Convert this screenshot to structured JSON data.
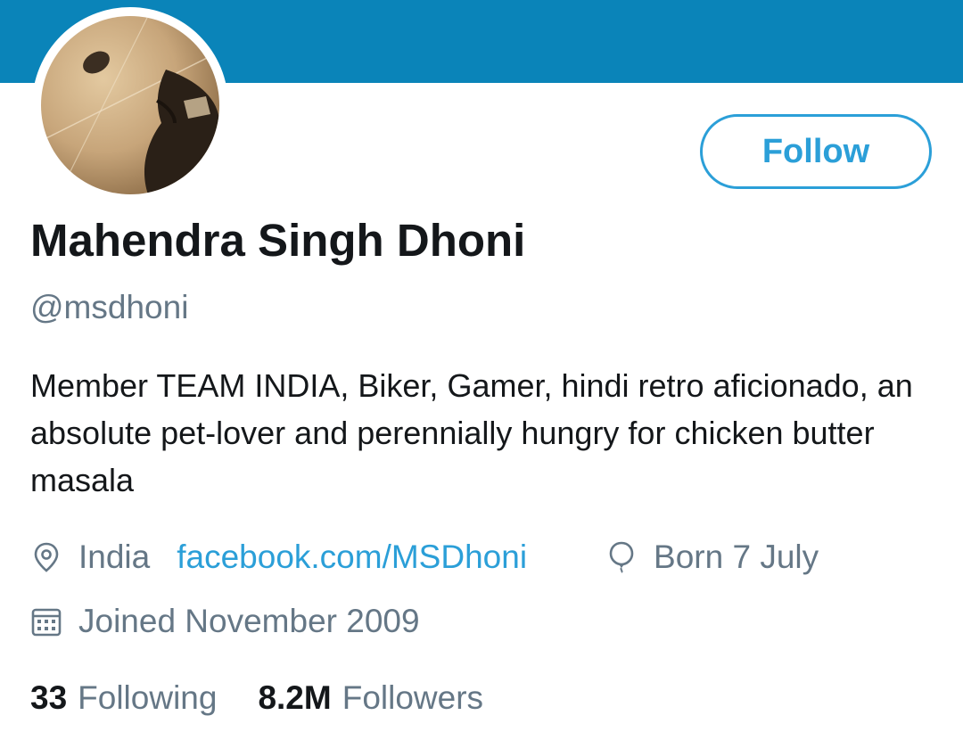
{
  "profile": {
    "name": "Mahendra Singh Dhoni",
    "handle": "@msdhoni",
    "bio": "Member TEAM INDIA, Biker, Gamer, hindi retro aficionado, an absolute pet-lover and perennially hungry for chicken butter masala",
    "location": "India",
    "website": "facebook.com/MSDhoni",
    "birthday": "Born 7 July",
    "joined": "Joined November 2009"
  },
  "actions": {
    "follow_label": "Follow"
  },
  "stats": {
    "following_count": "33",
    "following_label": "Following",
    "followers_count": "8.2M",
    "followers_label": "Followers"
  },
  "icons": {
    "location": "location-pin-icon",
    "birthday": "balloon-icon",
    "joined": "calendar-icon"
  },
  "colors": {
    "banner": "#0a84b9",
    "accent": "#2b9fd8",
    "text": "#14171a",
    "secondary": "#657786"
  }
}
